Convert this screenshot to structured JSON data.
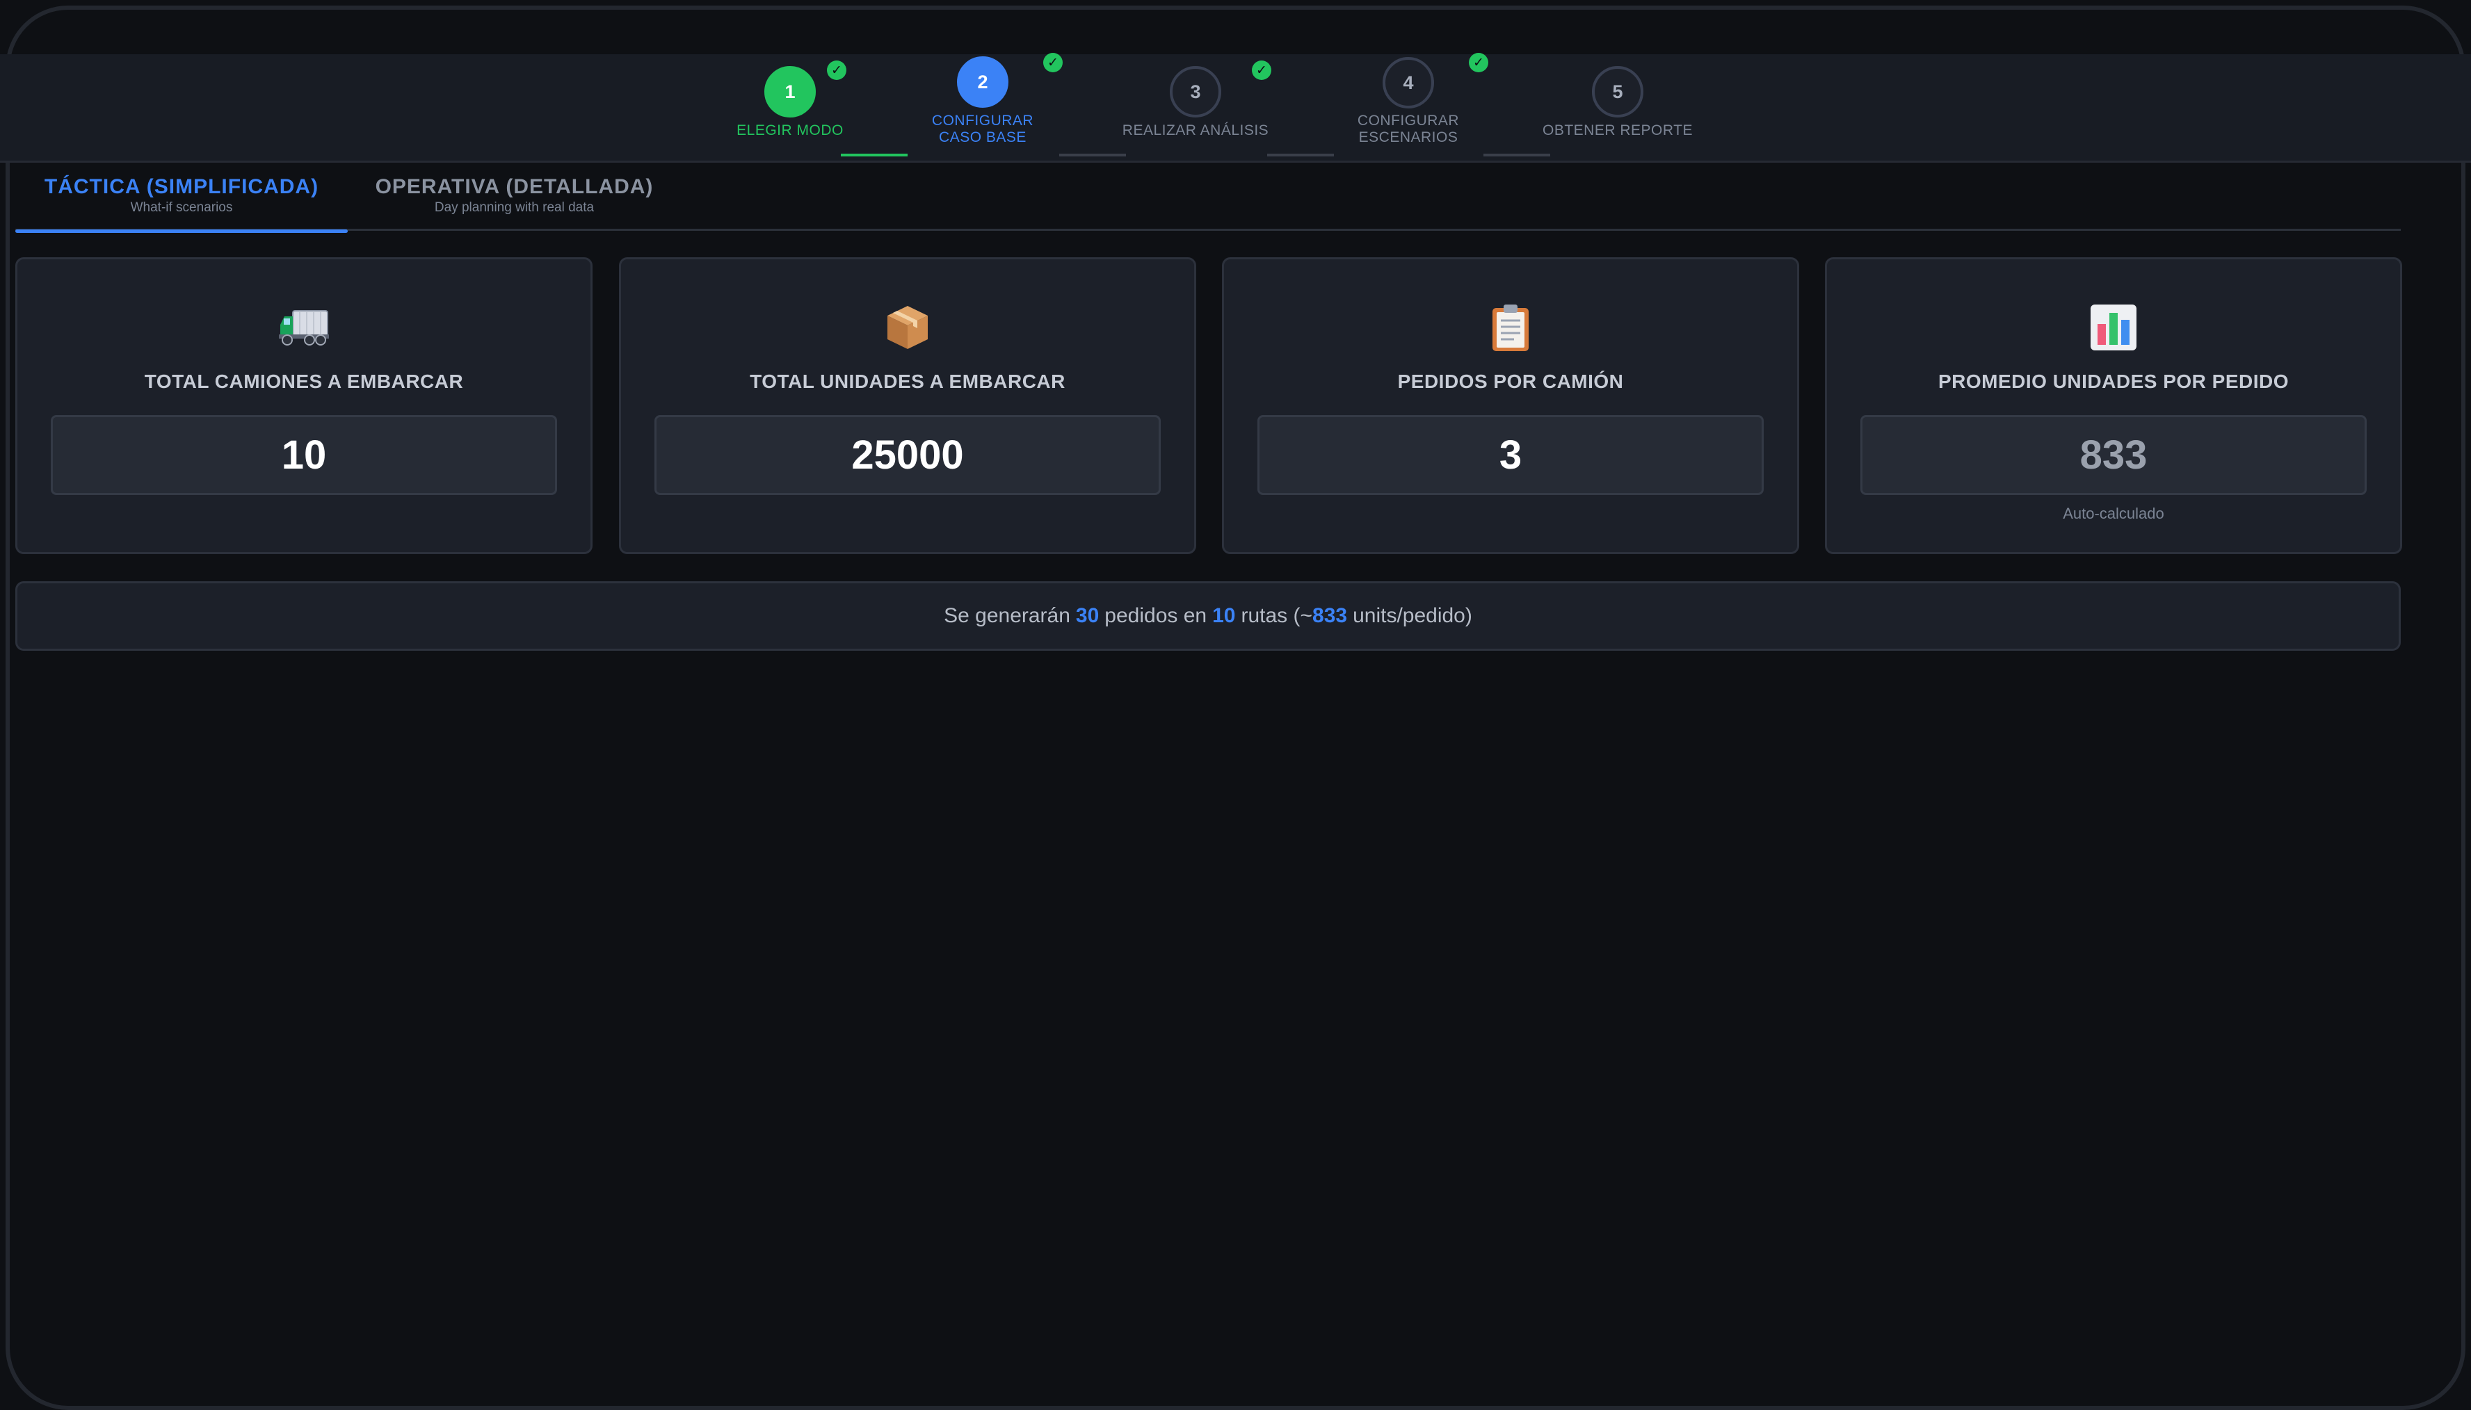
{
  "stepper": {
    "steps": [
      {
        "number": "1",
        "label": "ELEGIR MODO",
        "state": "done"
      },
      {
        "number": "2",
        "label": "CONFIGURAR CASO BASE",
        "state": "active"
      },
      {
        "number": "3",
        "label": "REALIZAR ANÁLISIS",
        "state": "pending"
      },
      {
        "number": "4",
        "label": "CONFIGURAR ESCENARIOS",
        "state": "pending"
      },
      {
        "number": "5",
        "label": "OBTENER REPORTE",
        "state": "pending"
      }
    ],
    "check_mark": "✓"
  },
  "tabs": [
    {
      "title": "TÁCTICA (SIMPLIFICADA)",
      "subtitle": "What-if scenarios",
      "active": true
    },
    {
      "title": "OPERATIVA (DETALLADA)",
      "subtitle": "Day planning with real data",
      "active": false
    }
  ],
  "cards": [
    {
      "icon": "truck-icon",
      "label": "TOTAL CAMIONES A EMBARCAR",
      "value": "10"
    },
    {
      "icon": "package-icon",
      "label": "TOTAL UNIDADES A EMBARCAR",
      "value": "25000"
    },
    {
      "icon": "clipboard-icon",
      "label": "PEDIDOS POR CAMIÓN",
      "value": "3"
    },
    {
      "icon": "bar-chart-icon",
      "label": "PROMEDIO UNIDADES POR PEDIDO",
      "value": "833",
      "note": "Auto-calculado"
    }
  ],
  "summary": {
    "prefix": "Se generarán",
    "orders": "30",
    "mid1": "pedidos en",
    "routes": "10",
    "mid2": "rutas (~",
    "avg": "833",
    "suffix": "units/pedido)"
  },
  "colors": {
    "done": "#22c55e",
    "active": "#3b82f6",
    "background": "#0e1014",
    "card": "#1c2029"
  }
}
